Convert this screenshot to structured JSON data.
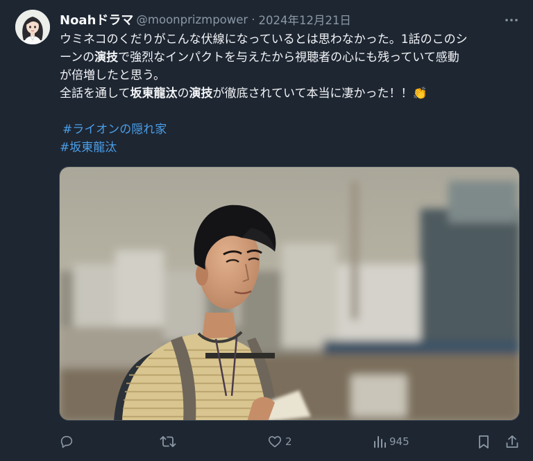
{
  "user": {
    "display_name": "Noahドラマ",
    "handle": "@moonprizmpower",
    "separator": "·",
    "date": "2024年12月21日"
  },
  "tweet": {
    "line1": "ウミネコのくだりがこんな伏線になっているとは思わなかった。1話のこのシ",
    "line2_a": "ーンの",
    "line2_b": "演技",
    "line2_c": "で強烈なインパクトを与えたから視聴者の心にも残っていて感動",
    "line3": "が倍増したと思う。",
    "line4_a": "全話を通して",
    "line4_b": "坂東龍汰",
    "line4_c": "の",
    "line4_d": "演技",
    "line4_e": "が徹底されていて本当に凄かった！！",
    "clap_emoji": "👏",
    "hashtags": [
      "#ライオンの隠れ家",
      "#坂東龍汰"
    ]
  },
  "actions": {
    "reply_count": "",
    "retweet_count": "",
    "like_count": "2",
    "views_count": "945"
  },
  "icons": {
    "more": "more-dots-icon",
    "reply": "reply-icon",
    "retweet": "retweet-icon",
    "like": "heart-icon",
    "views": "views-chart-icon",
    "bookmark": "bookmark-icon",
    "share": "share-icon"
  },
  "colors": {
    "background": "#1e2632",
    "text": "#f3f5f7",
    "secondary": "#8b98a5",
    "hashtag": "#4a9ee8"
  }
}
